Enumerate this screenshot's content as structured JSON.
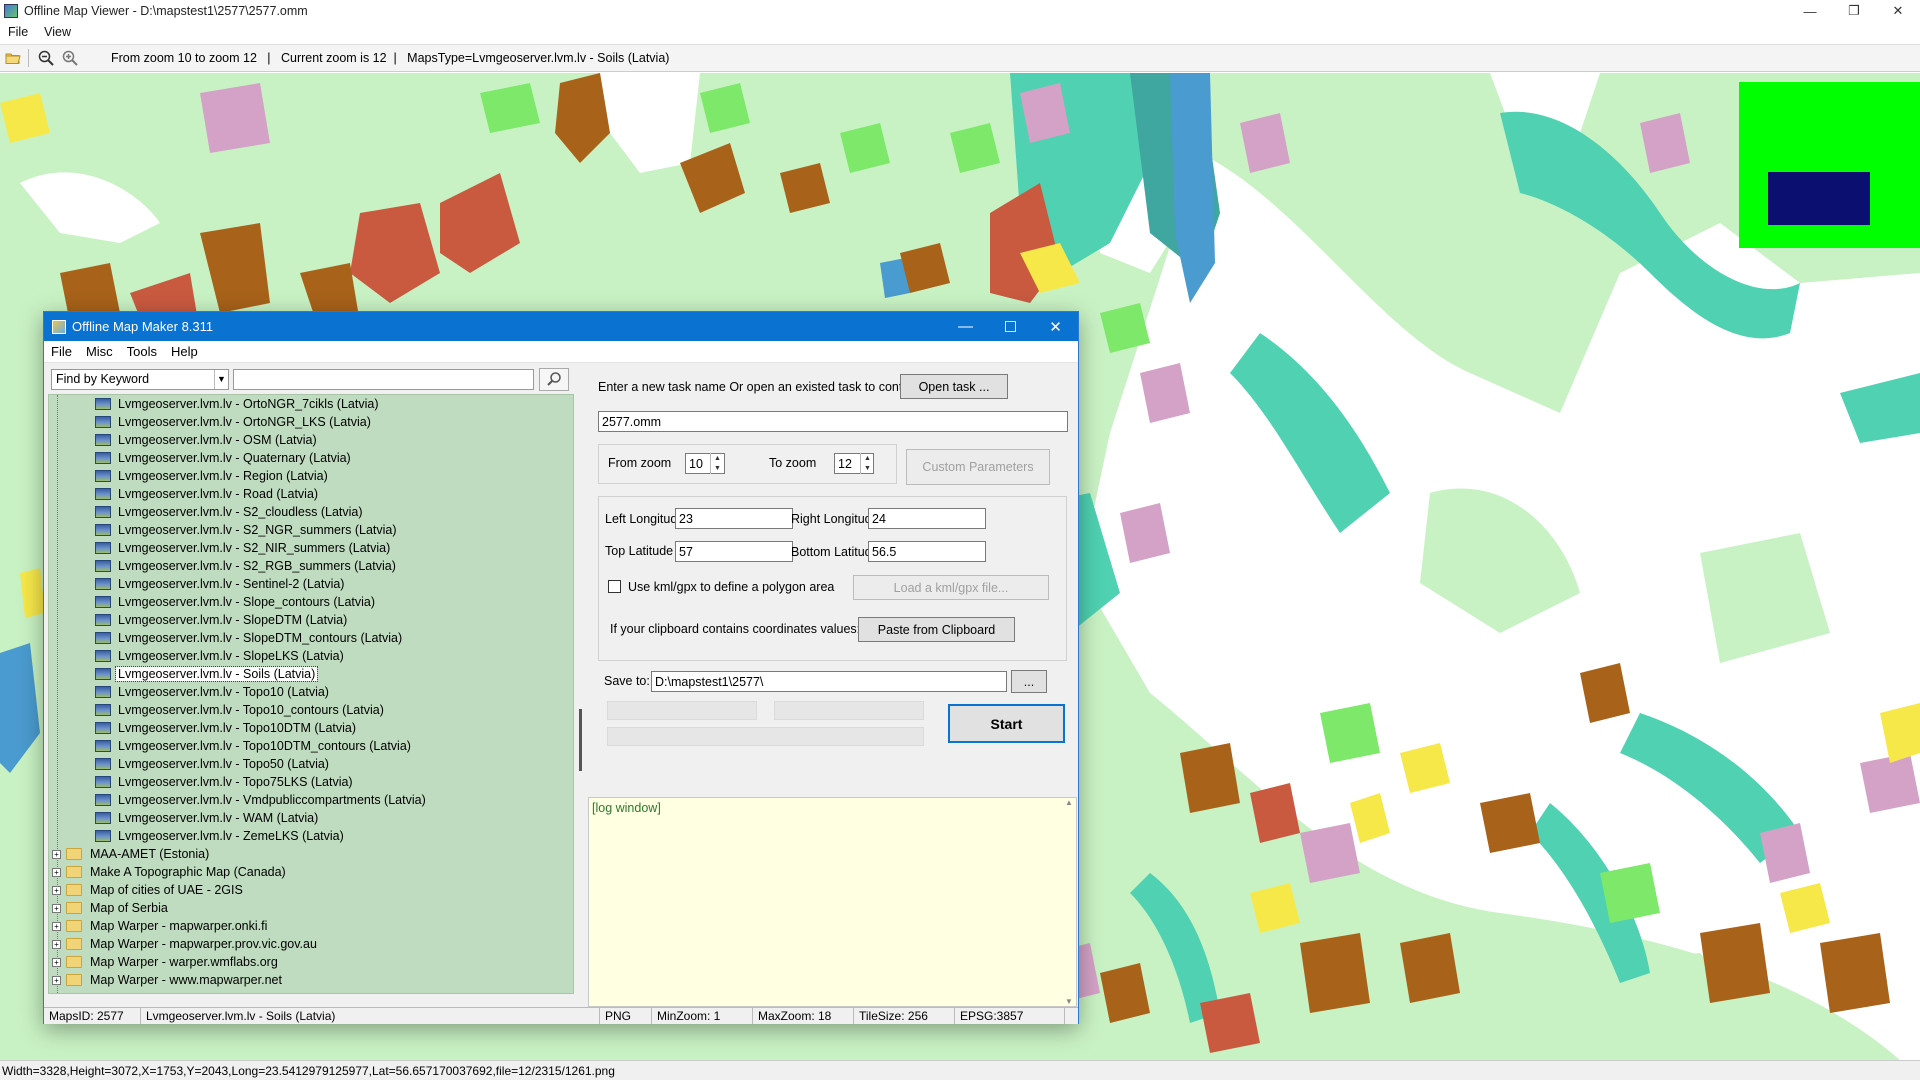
{
  "viewer": {
    "title": "Offline Map Viewer - D:\\mapstest1\\2577\\2577.omm",
    "menu": [
      "File",
      "View"
    ],
    "toolbar_info": "From zoom 10 to zoom 12   |   Current zoom is 12  |   MapsType=Lvmgeoserver.lvm.lv - Soils (Latvia)",
    "status": "Width=3328,Height=3072,X=1753,Y=2043,Long=23.5412979125977,Lat=56.657170037692,file=12/2315/1261.png",
    "controls": {
      "minimize": "—",
      "restore": "❐",
      "close": "✕"
    }
  },
  "dialog": {
    "title": "Offline Map Maker 8.311",
    "menu": [
      "File",
      "Misc",
      "Tools",
      "Help"
    ],
    "controls": {
      "minimize": "—",
      "maximize": "☐",
      "close": "✕"
    },
    "search": {
      "mode": "Find by Keyword",
      "value": "",
      "icon": "magnifier-icon"
    },
    "tree_leaves": [
      "Lvmgeoserver.lvm.lv - OrtoNGR_7cikls (Latvia)",
      "Lvmgeoserver.lvm.lv - OrtoNGR_LKS (Latvia)",
      "Lvmgeoserver.lvm.lv - OSM (Latvia)",
      "Lvmgeoserver.lvm.lv - Quaternary (Latvia)",
      "Lvmgeoserver.lvm.lv - Region (Latvia)",
      "Lvmgeoserver.lvm.lv - Road (Latvia)",
      "Lvmgeoserver.lvm.lv - S2_cloudless (Latvia)",
      "Lvmgeoserver.lvm.lv - S2_NGR_summers (Latvia)",
      "Lvmgeoserver.lvm.lv - S2_NIR_summers (Latvia)",
      "Lvmgeoserver.lvm.lv - S2_RGB_summers (Latvia)",
      "Lvmgeoserver.lvm.lv - Sentinel-2 (Latvia)",
      "Lvmgeoserver.lvm.lv - Slope_contours (Latvia)",
      "Lvmgeoserver.lvm.lv - SlopeDTM (Latvia)",
      "Lvmgeoserver.lvm.lv - SlopeDTM_contours (Latvia)",
      "Lvmgeoserver.lvm.lv - SlopeLKS (Latvia)",
      "Lvmgeoserver.lvm.lv - Soils (Latvia)",
      "Lvmgeoserver.lvm.lv - Topo10 (Latvia)",
      "Lvmgeoserver.lvm.lv - Topo10_contours (Latvia)",
      "Lvmgeoserver.lvm.lv - Topo10DTM (Latvia)",
      "Lvmgeoserver.lvm.lv - Topo10DTM_contours (Latvia)",
      "Lvmgeoserver.lvm.lv - Topo50 (Latvia)",
      "Lvmgeoserver.lvm.lv - Topo75LKS (Latvia)",
      "Lvmgeoserver.lvm.lv - Vmdpubliccompartments (Latvia)",
      "Lvmgeoserver.lvm.lv - WAM (Latvia)",
      "Lvmgeoserver.lvm.lv - ZemeLKS (Latvia)"
    ],
    "selected_leaf": "Lvmgeoserver.lvm.lv - Soils (Latvia)",
    "tree_folders": [
      "MAA-AMET (Estonia)",
      "Make A Topographic Map (Canada)",
      "Map of cities of UAE - 2GIS",
      "Map of Serbia",
      "Map Warper - mapwarper.onki.fi",
      "Map Warper - mapwarper.prov.vic.gov.au",
      "Map Warper - warper.wmflabs.org",
      "Map Warper - www.mapwarper.net"
    ],
    "task": {
      "prompt": "Enter a new task name Or open an existed task to continue:",
      "open_label": "Open task ...",
      "name": "2577.omm"
    },
    "zoom": {
      "from_label": "From zoom",
      "from_value": "10",
      "to_label": "To zoom",
      "to_value": "12",
      "custom_label": "Custom Parameters"
    },
    "bounds": {
      "left_label": "Left Longitude",
      "left_value": "23",
      "right_label": "Right Longitude",
      "right_value": "24",
      "top_label": "Top Latitude",
      "top_value": "57",
      "bottom_label": "Bottom Latitude",
      "bottom_value": "56.5"
    },
    "kml": {
      "label": "Use kml/gpx to define a polygon area",
      "checked": false,
      "load_label": "Load a kml/gpx file..."
    },
    "clipboard": {
      "label": "If your clipboard contains coordinates values:",
      "button": "Paste from Clipboard"
    },
    "save": {
      "label": "Save to:",
      "path": "D:\\mapstest1\\2577\\",
      "browse": "..."
    },
    "start_label": "Start",
    "log_text": "[log window]",
    "status": {
      "maps_id": "MapsID: 2577",
      "map_name": "Lvmgeoserver.lvm.lv - Soils (Latvia)",
      "format": "PNG",
      "min_zoom": "MinZoom: 1",
      "max_zoom": "MaxZoom: 18",
      "tile_size": "TileSize: 256",
      "epsg": "EPSG:3857"
    }
  },
  "colors": {
    "map_base": "#c9f2c4",
    "soil_teal": "#4fd1b2",
    "soil_brown": "#a8621a",
    "soil_red": "#c95a40",
    "soil_pink": "#d4a2c6",
    "soil_yellow": "#f7e84a",
    "water_blue": "#4a9bd0",
    "overview_green": "#00ff00",
    "overview_rect": "#0b0f70",
    "tree_bg": "#c0dcc0",
    "log_bg": "#ffffe1",
    "dialog_title": "#0a73d1"
  }
}
